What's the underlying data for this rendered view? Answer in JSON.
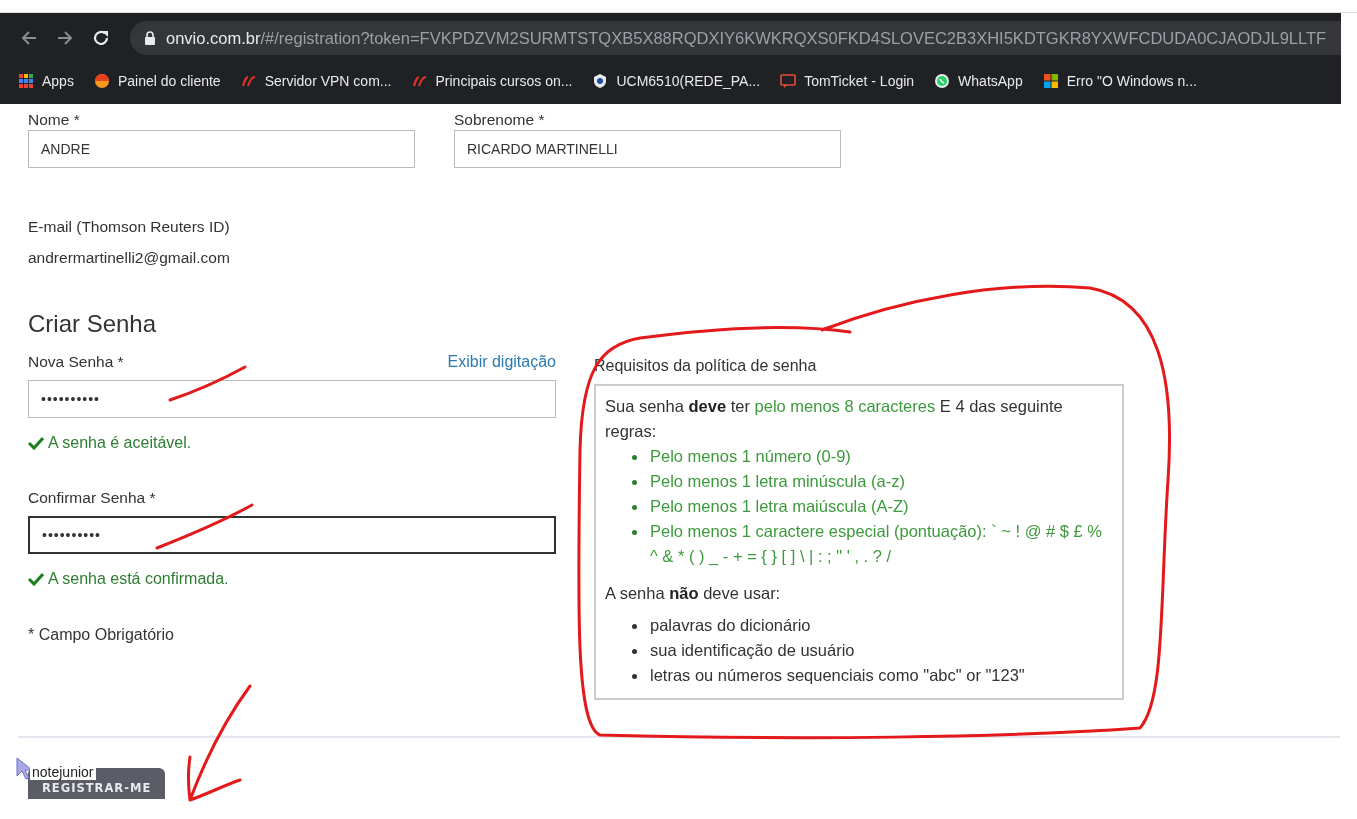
{
  "browser": {
    "url_host": "onvio.com.br",
    "url_path": "/#/registration?token=FVKPDZVM2SURMTSTQXB5X88RQDXIY6KWKRQXS0FKD4SLOVEC2B3XHI5KDTGKR8YXWFCDUDA0CJAODJL9LLTF",
    "bookmarks": [
      {
        "label": "Apps",
        "kind": "apps"
      },
      {
        "label": "Painel do cliente",
        "kind": "orange"
      },
      {
        "label": "Servidor VPN com...",
        "kind": "red"
      },
      {
        "label": "Principais cursos on...",
        "kind": "red"
      },
      {
        "label": "UCM6510(REDE_PA...",
        "kind": "shield"
      },
      {
        "label": "TomTicket - Login",
        "kind": "chat"
      },
      {
        "label": "WhatsApp",
        "kind": "whatsapp"
      },
      {
        "label": "Erro \"O Windows n...",
        "kind": "windows"
      }
    ]
  },
  "form": {
    "first_name": {
      "label": "Nome *",
      "value": "ANDRE"
    },
    "last_name": {
      "label": "Sobrenome *",
      "value": "RICARDO MARTINELLI"
    },
    "email": {
      "label": "E-mail (Thomson Reuters ID)",
      "value": "andrermartinelli2@gmail.com"
    },
    "section_title": "Criar Senha",
    "new_password": {
      "label": "Nova Senha *",
      "value": "••••••••••",
      "toggle": "Exibir digitação",
      "status": "A senha é aceitável.",
      "valid": true
    },
    "confirm_password": {
      "label": "Confirmar Senha *",
      "value": "••••••••••",
      "status": "A senha está confirmada.",
      "valid": true,
      "focused": true
    },
    "required_note": "* Campo Obrigatório"
  },
  "policy": {
    "title": "Requisitos da política de senha",
    "intro": [
      {
        "text": "Sua senha ",
        "kind": "plain"
      },
      {
        "text": "deve",
        "kind": "strong"
      },
      {
        "text": " ter ",
        "kind": "plain"
      },
      {
        "text": "pelo menos 8 caracteres",
        "kind": "met"
      },
      {
        "text": " E 4 das seguinte regras:",
        "kind": "plain"
      }
    ],
    "rules": [
      {
        "text": "Pelo menos 1 número (0-9)",
        "met": true
      },
      {
        "text": "Pelo menos 1 letra minúscula (a-z)",
        "met": true
      },
      {
        "text": "Pelo menos 1 letra maiúscula (A-Z)",
        "met": true
      },
      {
        "text": "Pelo menos 1 caractere especial (pontuação): ` ~ ! @ # $ £ % ^ & * ( ) _ - + = { } [ ] \\ | : ; \" ' , . ? /",
        "met": true
      }
    ],
    "prohibited_title": "A senha **não** deve usar:",
    "prohibited": [
      "palavras do dicionário",
      "sua identificação de usuário",
      "letras ou números sequenciais como \"abc\" or \"123\""
    ]
  },
  "footer": {
    "tooltip": "notejunior",
    "button": "REGISTRAR-ME"
  }
}
